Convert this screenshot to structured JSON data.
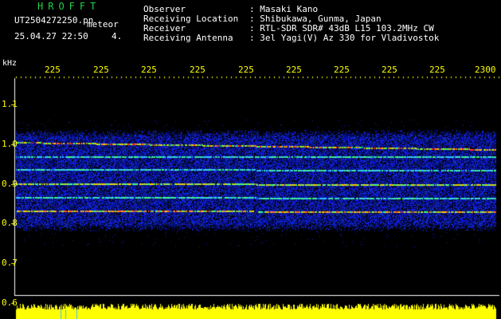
{
  "header": {
    "brand": "HROFFT",
    "filename": "UT2504272250.pn",
    "mode": "meteor",
    "datetime": "25.04.27 22:50",
    "count": "4."
  },
  "info": {
    "rows": [
      {
        "label": "Observer",
        "value": ": Masaki Kano"
      },
      {
        "label": "Receiving Location",
        "value": ": Shibukawa, Gunma, Japan"
      },
      {
        "label": "Receiver",
        "value": ": RTL-SDR SDR# 43dB L15 103.2MHz CW"
      },
      {
        "label": "Receiving Antenna",
        "value": ": 3el Yagi(V) Az 330 for Vladivostok"
      }
    ]
  },
  "axis": {
    "y_unit": "kHz",
    "y_ticks": [
      "1.1",
      "1.0",
      "0.9",
      "0.8",
      "0.7",
      "0.6"
    ],
    "x_ticks": [
      "225",
      "225",
      "225",
      "225",
      "225",
      "225",
      "225",
      "225",
      "225",
      "2300"
    ]
  },
  "colors": {
    "text": "#ffffff",
    "brand": "#22d04a",
    "tick": "#ffff00",
    "background": "#000000",
    "noise": "#1a2fd6",
    "amplitude": "#ffff00"
  }
}
